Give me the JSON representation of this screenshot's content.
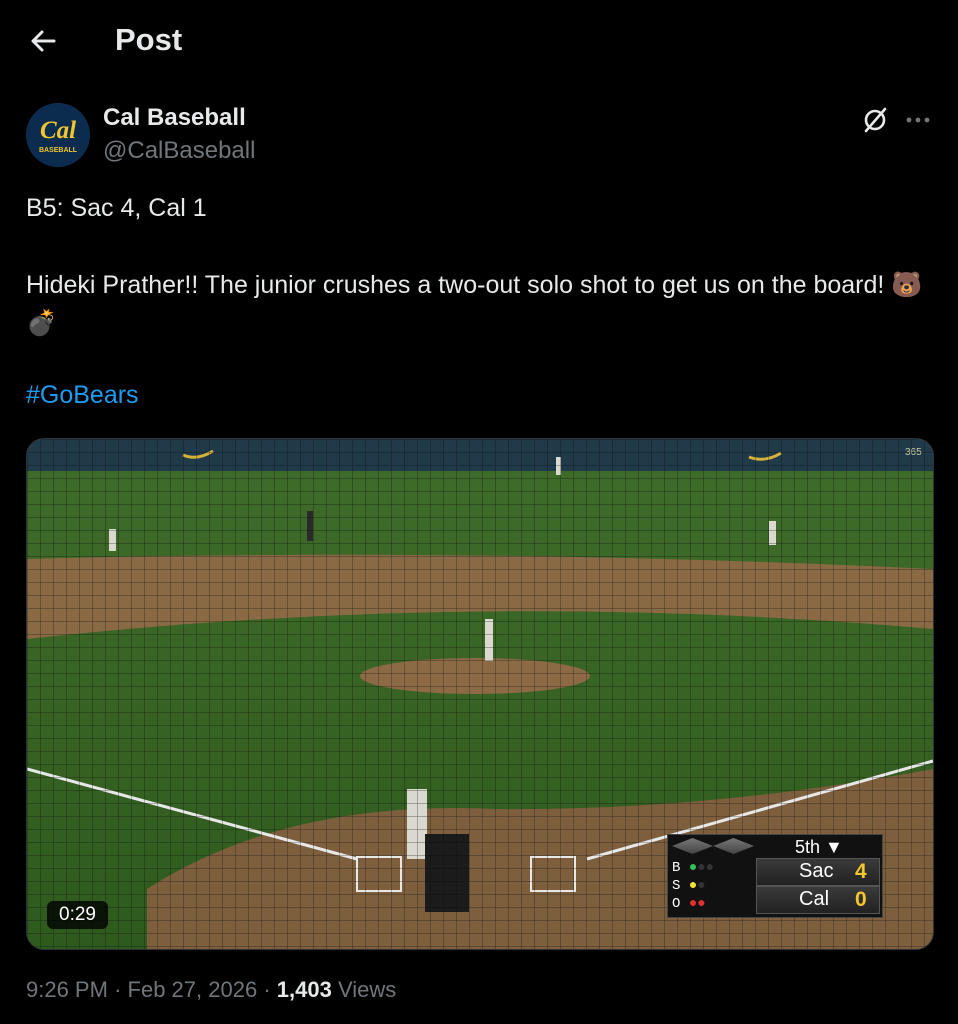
{
  "header": {
    "title": "Post",
    "back_icon": "arrow-left-icon"
  },
  "author": {
    "display_name": "Cal Baseball",
    "handle": "@CalBaseball",
    "avatar_text_top": "Cal",
    "avatar_text_bottom": "BASEBALL"
  },
  "tweet": {
    "line1": "B5: Sac 4, Cal 1",
    "line2": "Hideki Prather!! The junior crushes a two-out solo shot to get us on the board! 🐻💣",
    "hashtag": "#GoBears"
  },
  "media": {
    "duration": "0:29",
    "scoreboard": {
      "inning": "5th",
      "teams": [
        {
          "name": "Sac",
          "score": "4"
        },
        {
          "name": "Cal",
          "score": "0"
        }
      ],
      "count_labels": [
        "B",
        "S",
        "O"
      ]
    },
    "wall_sign": "365"
  },
  "meta": {
    "time": "9:26 PM",
    "date": "Feb 27, 2026",
    "views_count": "1,403",
    "views_label": "Views",
    "sep": "·"
  },
  "colors": {
    "link": "#1d9bf0",
    "muted": "#71767b",
    "text": "#e7e9ea",
    "score": "#f2c72d"
  }
}
